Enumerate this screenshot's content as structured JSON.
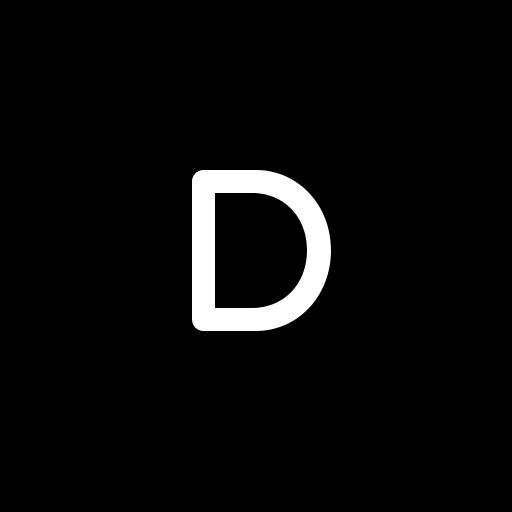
{
  "icon": {
    "monogram": "D",
    "background_color": "#000000",
    "glyph_color": "#ffffff"
  }
}
